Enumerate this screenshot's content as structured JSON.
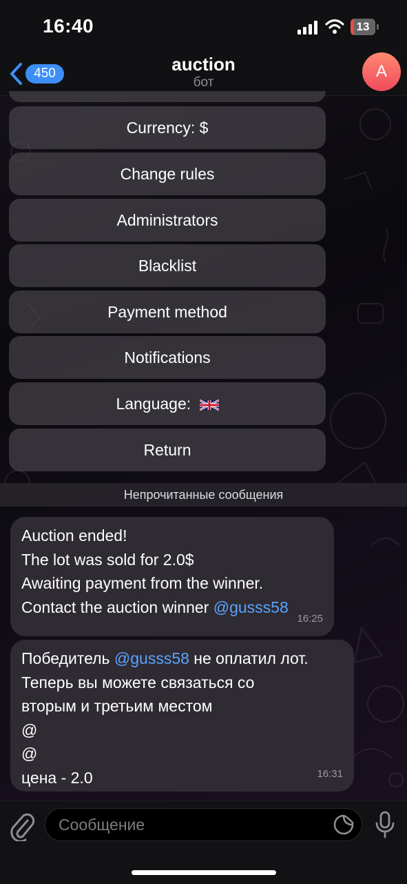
{
  "status_bar": {
    "time": "16:40",
    "battery_level": "13",
    "battery_fraction": 0.13,
    "icons": [
      "signal-icon",
      "wifi-icon",
      "battery-icon"
    ]
  },
  "header": {
    "back_badge": "450",
    "title": "auction",
    "subtitle": "бот",
    "avatar_letter": "A",
    "avatar_color": "#f04a5e"
  },
  "keyboard": {
    "buttons": [
      {
        "label": "Currency: $"
      },
      {
        "label": "Change rules"
      },
      {
        "label": "Administrators"
      },
      {
        "label": "Blacklist"
      },
      {
        "label": "Payment method"
      },
      {
        "label": "Notifications"
      },
      {
        "label": "Language:",
        "flag": "uk-flag-icon"
      },
      {
        "label": "Return"
      }
    ]
  },
  "unread_separator": "Непрочитанные сообщения",
  "messages": [
    {
      "lines": [
        "Auction ended!",
        "The lot was sold for 2.0$",
        "Awaiting payment from the winner."
      ],
      "last_line_prefix": "Contact the auction winner ",
      "last_line_mention": "@gusss58",
      "time": "16:25"
    },
    {
      "first_line_prefix": "Победитель ",
      "first_line_mention": "@gusss58",
      "first_line_suffix": " не оплатил лот.",
      "lines": [
        "Теперь вы можете связаться со",
        "вторым и третьим местом",
        "@",
        "@",
        "цена - 2.0"
      ],
      "time": "16:31"
    }
  ],
  "input": {
    "placeholder": "Сообщение"
  },
  "colors": {
    "accent": "#3d8ef7",
    "mention": "#5aa3ff",
    "bubble": "#2f2b33",
    "keyboard_button": "#535056",
    "battery_low": "#eb4d3d"
  }
}
